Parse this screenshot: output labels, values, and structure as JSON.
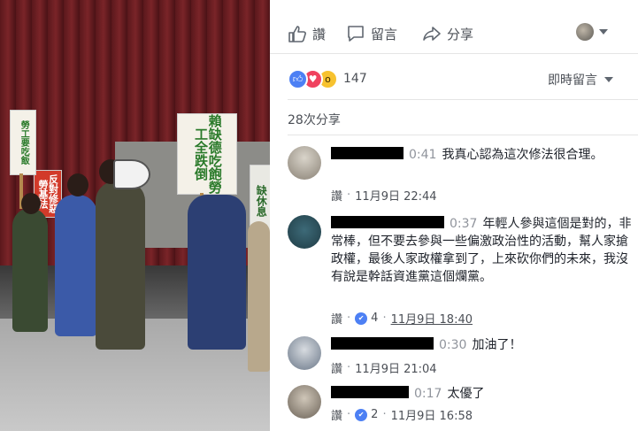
{
  "actions": {
    "like_label": "讚",
    "comment_label": "留言",
    "share_label": "分享"
  },
  "reactions": {
    "count": "147",
    "sort_label": "即時留言"
  },
  "shares_label": "28次分享",
  "comments": [
    {
      "timecode": "0:41",
      "text": "我真心認為這次修法很合理。",
      "like_label": "讚",
      "date": "11月9日 22:44"
    },
    {
      "timecode": "0:37",
      "text": "年輕人參與這個是對的，非常棒，但不要去參與一些偏激政治性的活動，幫人家搶政權，最後人家政權拿到了，上來砍你們的未來，我沒有說是幹話資進黨這個爛黨。",
      "like_label": "讚",
      "likes": "4",
      "date": "11月9日 18:40"
    },
    {
      "timecode": "0:30",
      "text": "加油了！",
      "like_label": "讚",
      "date": "11月9日 21:04"
    },
    {
      "timecode": "0:17",
      "text": "太優了",
      "like_label": "讚",
      "likes": "2",
      "date": "11月9日 16:58"
    }
  ],
  "video_signs": {
    "sign1": "賴缺德吃飽勞工全跌倒",
    "sign2": "反對修惡勞基法",
    "sign3": "勞工要吃飯",
    "sign4": "缺休息"
  }
}
